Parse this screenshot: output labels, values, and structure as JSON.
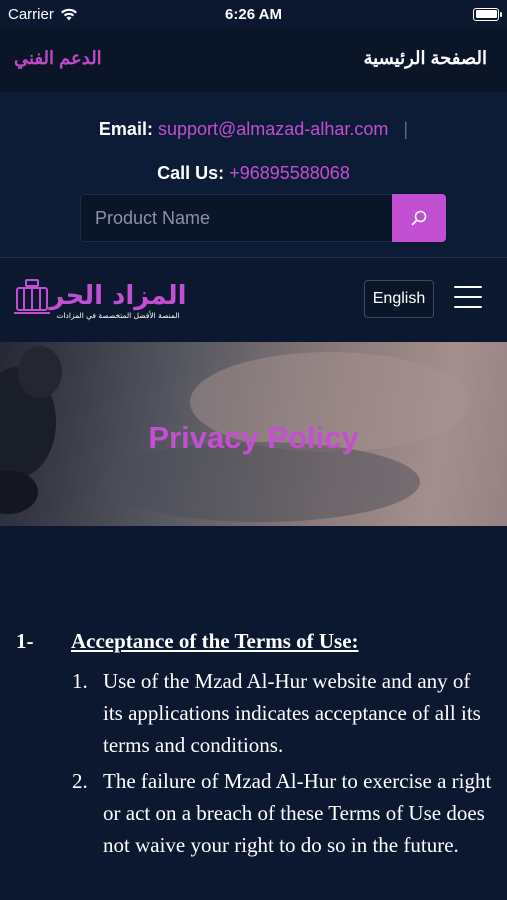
{
  "status_bar": {
    "carrier": "Carrier",
    "time": "6:26 AM"
  },
  "top_nav": {
    "home": "الصفحة الرئيسية",
    "support": "الدعم الفني"
  },
  "contact": {
    "email_label": "Email:",
    "email": "support@almazad-alhar.com",
    "separator": "|",
    "call_label": "Call Us:",
    "phone": "+96895588068"
  },
  "search": {
    "placeholder": "Product Name"
  },
  "logo": {
    "title": "المزاد الحر",
    "subtitle": "المنصة الأفضل المتخصصة في المزادات"
  },
  "header": {
    "language": "English"
  },
  "hero": {
    "title": "Privacy Policy"
  },
  "content": {
    "section_number": "1-",
    "section_title": "Acceptance of the Terms of Use:",
    "items": [
      {
        "num": "1.",
        "text": "Use of the Mzad Al-Hur website and any of its applications indicates acceptance of all its terms and conditions."
      },
      {
        "num": "2.",
        "text": "The failure of Mzad Al-Hur to exercise a right or act on a breach of these Terms of Use does not waive your right to do so in the future."
      }
    ]
  },
  "colors": {
    "accent": "#c24fd1",
    "background": "#0b1830"
  }
}
